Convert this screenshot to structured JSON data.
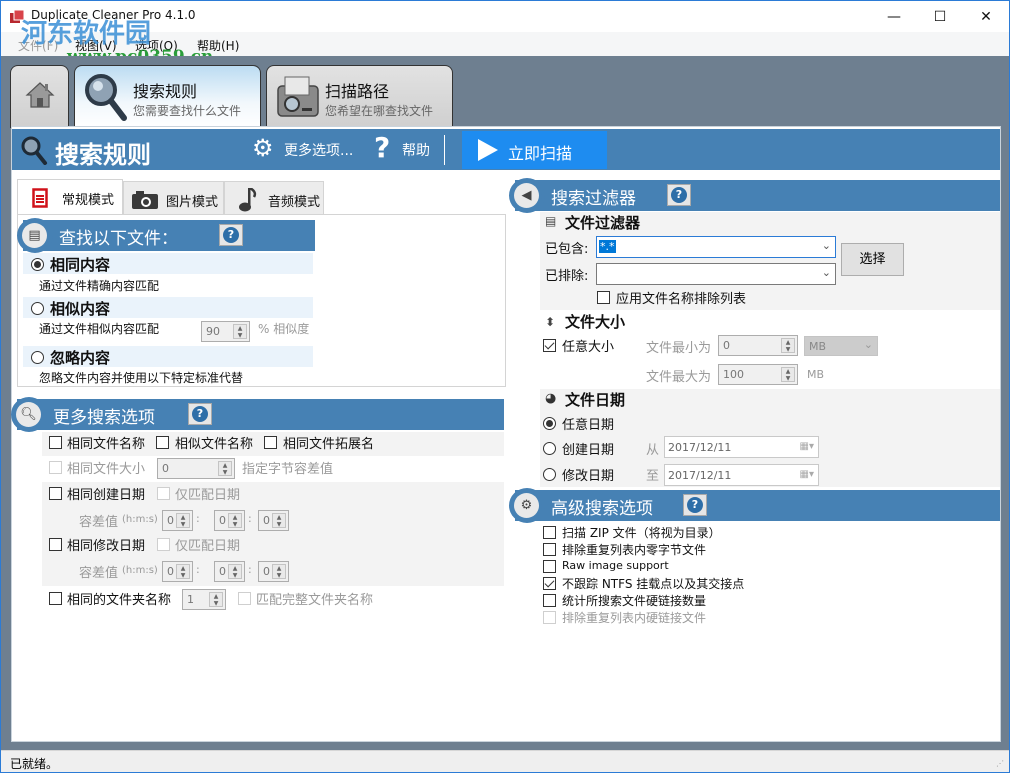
{
  "window": {
    "title": "Duplicate Cleaner Pro 4.1.0",
    "controls": {
      "minimize": "—",
      "maximize": "☐",
      "close": "✕"
    }
  },
  "watermark": {
    "name": "河东软件园",
    "url": "www.pc0359.cn"
  },
  "menu": [
    "文件(F)",
    "视图(V)",
    "选项(O)",
    "帮助(H)"
  ],
  "nav_tabs": [
    {
      "icon": "home-icon"
    },
    {
      "title": "搜索规则",
      "subtitle": "您需要查找什么文件",
      "icon": "magnifier-icon",
      "active": true
    },
    {
      "title": "扫描路径",
      "subtitle": "您希望在哪查找文件",
      "icon": "folder-search-icon"
    }
  ],
  "header": {
    "title": "搜索规则",
    "more_options": "更多选项...",
    "help": "帮助",
    "scan_now": "立即扫描"
  },
  "mode_tabs": [
    {
      "label": "常规模式",
      "icon": "document-icon",
      "active": true
    },
    {
      "label": "图片模式",
      "icon": "camera-icon"
    },
    {
      "label": "音频模式",
      "icon": "music-note-icon"
    }
  ],
  "find_files": {
    "title": "查找以下文件：",
    "options": [
      {
        "label": "相同内容",
        "desc": "通过文件精确内容匹配",
        "selected": true
      },
      {
        "label": "相似内容",
        "desc": "通过文件相似内容匹配",
        "selected": false,
        "similarity_value": "90",
        "similarity_label": "% 相似度"
      },
      {
        "label": "忽略内容",
        "desc": "忽略文件内容并使用以下特定标准代替",
        "selected": false
      }
    ]
  },
  "more_search": {
    "title": "更多搜索选项",
    "same_name": "相同文件名称",
    "similar_name": "相似文件名称",
    "same_ext": "相同文件拓展名",
    "same_size": "相同文件大小",
    "size_tolerance_value": "0",
    "size_tolerance_label": "指定字节容差值",
    "same_created": "相同创建日期",
    "created_date_only": "仅匹配日期",
    "tolerance_label": "容差值",
    "tolerance_unit": "(h:m:s)",
    "created_tol": [
      "0",
      "0",
      "0"
    ],
    "same_modified": "相同修改日期",
    "modified_date_only": "仅匹配日期",
    "modified_tol": [
      "0",
      "0",
      "0"
    ],
    "same_folder": "相同的文件夹名称",
    "folder_level": "1",
    "full_folder": "匹配完整文件夹名称",
    "sep": ":"
  },
  "search_filter": {
    "title": "搜索过滤器",
    "file_filter_title": "文件过滤器",
    "include_label": "已包含:",
    "include_value": "*.*",
    "exclude_label": "已排除:",
    "exclude_value": "",
    "select_button": "选择",
    "apply_exclude_list": "应用文件名称排除列表",
    "size_title": "文件大小",
    "any_size": "任意大小",
    "any_size_checked": true,
    "min_label": "文件最小为",
    "min_value": "0",
    "min_unit": "MB",
    "max_label": "文件最大为",
    "max_value": "100",
    "max_unit": "MB",
    "date_title": "文件日期",
    "any_date": "任意日期",
    "created_date": "创建日期",
    "from_label": "从",
    "from_value": "2017/12/11",
    "modified_date": "修改日期",
    "to_label": "至",
    "to_value": "2017/12/11"
  },
  "advanced": {
    "title": "高级搜索选项",
    "items": [
      {
        "label": "扫描 ZIP 文件（将视为目录）",
        "checked": false,
        "disabled": false
      },
      {
        "label": "排除重复列表内零字节文件",
        "checked": false,
        "disabled": false
      },
      {
        "label": "Raw image support",
        "checked": false,
        "disabled": false
      },
      {
        "label": "不跟踪 NTFS 挂载点以及其交接点",
        "checked": true,
        "disabled": false
      },
      {
        "label": "统计所搜索文件硬链接数量",
        "checked": false,
        "disabled": false
      },
      {
        "label": "排除重复列表内硬链接文件",
        "checked": false,
        "disabled": true
      }
    ]
  },
  "status": "已就绪。",
  "colors": {
    "header_blue": "#4681b4",
    "scan_blue": "#1e8cf0",
    "frame": "#6e7f90"
  }
}
